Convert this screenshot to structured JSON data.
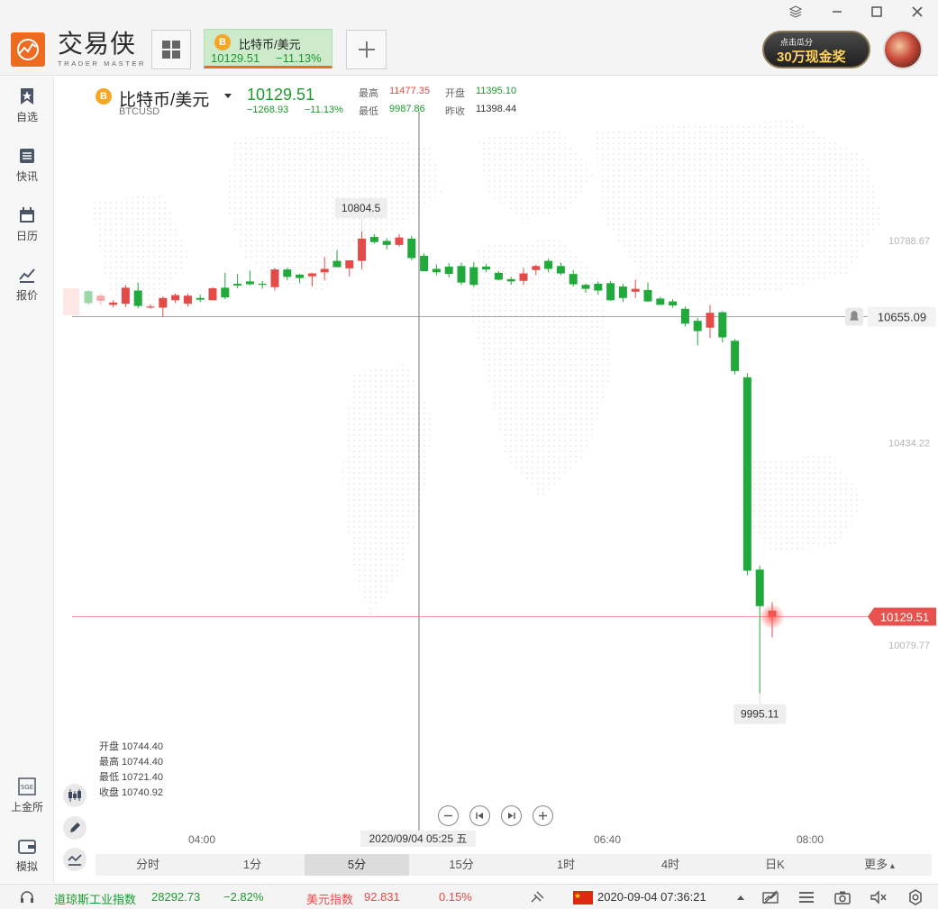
{
  "app": {
    "brand_cn": "交易侠",
    "brand_en": "TRADER MASTER",
    "promo_line1": "点击瓜分",
    "promo_line2": "30万现金奖"
  },
  "symbol_tab": {
    "name": "比特币/美元",
    "price": "10129.51",
    "change": "−11.13%",
    "coin_glyph": "B"
  },
  "nav": [
    {
      "label": "自选",
      "icon": "bookmark-icon"
    },
    {
      "label": "快讯",
      "icon": "news-list-icon"
    },
    {
      "label": "日历",
      "icon": "calendar-icon"
    },
    {
      "label": "报价",
      "icon": "trend-line-icon"
    },
    {
      "label": "上金所",
      "icon": "sge-icon"
    },
    {
      "label": "模拟",
      "icon": "wallet-icon"
    }
  ],
  "header": {
    "pair": "比特币/美元",
    "code": "BTCUSD",
    "last": "10129.51",
    "diff": "−1268.93",
    "diff_pct": "−11.13%",
    "high_label": "最高",
    "high": "11477.35",
    "open_label": "开盘",
    "open": "11395.10",
    "low_label": "最低",
    "low": "9987.86",
    "prev_label": "昨收",
    "prev": "11398.44"
  },
  "cursor_ohlc": {
    "open": "开盘 10744.40",
    "high": "最高 10744.40",
    "low": "最低 10721.40",
    "close": "收盘 10740.92"
  },
  "chart_data": {
    "type": "candlestick",
    "interval": "5分",
    "y_ticks": [
      10788.67,
      10434.22,
      10079.77
    ],
    "ylim": [
      9965,
      10880
    ],
    "x_ticks": [
      "04:00",
      "06:40",
      "08:00"
    ],
    "crosshair_label": "2020/09/04 05:25 五",
    "max_label": "10804.5",
    "min_label": "9995.11",
    "alert_price": "10655.09",
    "last_price": "10129.51",
    "candles": [
      [
        10700,
        10702,
        10676,
        10679
      ],
      [
        10683,
        10695,
        10676,
        10692
      ],
      [
        10676,
        10684,
        10672,
        10680
      ],
      [
        10678,
        10711,
        10672,
        10706
      ],
      [
        10701,
        10715,
        10670,
        10674
      ],
      [
        10672,
        10677,
        10669,
        10673
      ],
      [
        10671,
        10691,
        10655,
        10688
      ],
      [
        10684,
        10696,
        10679,
        10693
      ],
      [
        10678,
        10696,
        10673,
        10692
      ],
      [
        10688,
        10694,
        10681,
        10685
      ],
      [
        10684,
        10707,
        10684,
        10705
      ],
      [
        10706,
        10732,
        10686,
        10689
      ],
      [
        10713,
        10730,
        10705,
        10710
      ],
      [
        10717,
        10736,
        10710,
        10712
      ],
      [
        10713,
        10718,
        10704,
        10711
      ],
      [
        10707,
        10741,
        10701,
        10738
      ],
      [
        10738,
        10741,
        10719,
        10725
      ],
      [
        10729,
        10730,
        10714,
        10723
      ],
      [
        10726,
        10732,
        10708,
        10731
      ],
      [
        10733,
        10760,
        10719,
        10739
      ],
      [
        10753,
        10772,
        10744,
        10742
      ],
      [
        10740,
        10752,
        10726,
        10754
      ],
      [
        10753,
        10804.5,
        10738,
        10792
      ],
      [
        10795,
        10800,
        10783,
        10786
      ],
      [
        10788,
        10793,
        10773,
        10781
      ],
      [
        10781,
        10800,
        10778,
        10794
      ],
      [
        10792,
        10797,
        10754,
        10758
      ],
      [
        10762,
        10766,
        10735,
        10735
      ],
      [
        10739,
        10747,
        10728,
        10733
      ],
      [
        10743,
        10749,
        10724,
        10730
      ],
      [
        10744,
        10750,
        10711,
        10715
      ],
      [
        10742,
        10751,
        10707,
        10711
      ],
      [
        10743,
        10748,
        10733,
        10738
      ],
      [
        10732,
        10735,
        10719,
        10720
      ],
      [
        10721,
        10725,
        10711,
        10717
      ],
      [
        10718,
        10741,
        10711,
        10731
      ],
      [
        10737,
        10746,
        10728,
        10744
      ],
      [
        10753,
        10757,
        10733,
        10739
      ],
      [
        10744,
        10750,
        10728,
        10731
      ],
      [
        10730,
        10737,
        10708,
        10712
      ],
      [
        10711,
        10713,
        10697,
        10704
      ],
      [
        10713,
        10717,
        10694,
        10701
      ],
      [
        10714,
        10718,
        10683,
        10684
      ],
      [
        10708,
        10713,
        10681,
        10688
      ],
      [
        10699,
        10720,
        10688,
        10704
      ],
      [
        10702,
        10715,
        10681,
        10682
      ],
      [
        10687,
        10690,
        10676,
        10676
      ],
      [
        10682,
        10686,
        10671,
        10675
      ],
      [
        10669,
        10673,
        10638,
        10643
      ],
      [
        10648,
        10653,
        10605,
        10630
      ],
      [
        10636,
        10676,
        10618,
        10662
      ],
      [
        10663,
        10665,
        10610,
        10619
      ],
      [
        10613,
        10616,
        10554,
        10560
      ],
      [
        10549,
        10556,
        10202,
        10210
      ],
      [
        10212,
        10219,
        9995.11,
        10148
      ],
      [
        10129,
        10155,
        10093,
        10140
      ]
    ]
  },
  "periods": [
    "分时",
    "1分",
    "5分",
    "15分",
    "1时",
    "4时",
    "日K",
    "更多"
  ],
  "active_period": 2,
  "status": {
    "idx1_name": "道琼斯工业指数",
    "idx1_value": "28292.73",
    "idx1_change": "−2.82%",
    "idx2_name": "美元指数",
    "idx2_value": "92.831",
    "idx2_change": "0.15%",
    "datetime": "2020-09-04 07:36:21"
  },
  "colors": {
    "up": "#e34b48",
    "down": "#22a93b",
    "accent": "#ee6a1f"
  }
}
